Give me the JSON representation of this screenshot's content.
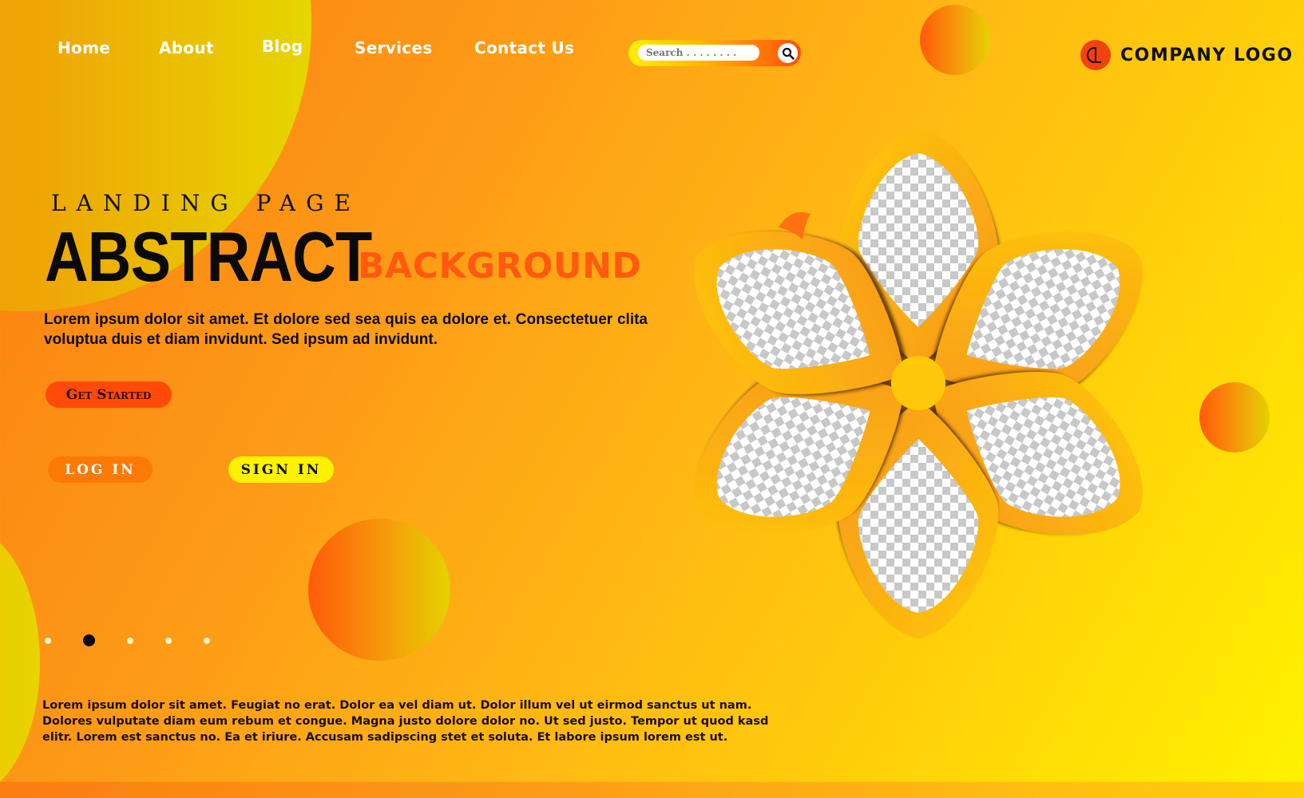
{
  "nav": {
    "items": [
      {
        "label": "Home"
      },
      {
        "label": "About"
      },
      {
        "label": "Blog"
      },
      {
        "label": "Services"
      },
      {
        "label": "Contact Us"
      }
    ]
  },
  "search": {
    "placeholder": "Search . . . . . . . .",
    "value": "",
    "button_icon": "search-icon"
  },
  "logo": {
    "mark": "CL",
    "text": "COMPANY LOGO"
  },
  "hero": {
    "kicker": "LANDING PAGE",
    "title": "ABSTRACT",
    "subtitle": "BACKGROUND",
    "lead": "Lorem ipsum dolor sit amet. Et dolore sed sea quis ea dolore et. Consectetuer clita voluptua duis et diam invidunt. Sed ipsum ad invidunt."
  },
  "buttons": {
    "get_started": "Get Started",
    "log_in": "LOG IN",
    "sign_in": "SIGN IN"
  },
  "pagination": {
    "count": 5,
    "active_index": 1
  },
  "footer": {
    "text": "Lorem ipsum dolor sit amet. Feugiat no erat. Dolor ea vel diam ut. Dolor illum vel ut eirmod sanctus ut nam. Dolores vulputate diam eum rebum et congue. Magna justo dolore dolor no. Ut sed justo. Tempor ut quod kasd elitr. Lorem est sanctus no. Ea et iriure. Accusam sadipscing stet et soluta. Et labore ipsum lorem est ut."
  },
  "graphic": {
    "petal_count": 6,
    "placeholder": "transparent-checkerboard"
  },
  "colors": {
    "accent_orange": "#ff5a0f",
    "accent_yellow": "#fff200",
    "text_dark": "#0a0a0a"
  }
}
